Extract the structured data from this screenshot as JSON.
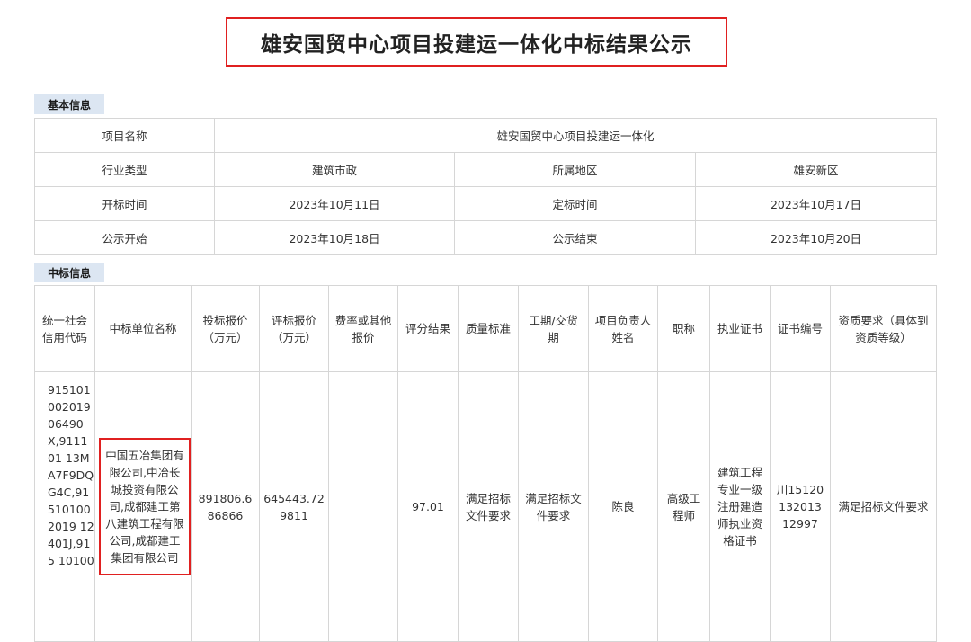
{
  "title": "雄安国贸中心项目投建运一体化中标结果公示",
  "basic": {
    "section_label": "基本信息",
    "project_name_label": "项目名称",
    "project_name_value": "雄安国贸中心项目投建运一体化",
    "industry_label": "行业类型",
    "industry_value": "建筑市政",
    "region_label": "所属地区",
    "region_value": "雄安新区",
    "open_time_label": "开标时间",
    "open_time_value": "2023年10月11日",
    "decide_time_label": "定标时间",
    "decide_time_value": "2023年10月17日",
    "publish_start_label": "公示开始",
    "publish_start_value": "2023年10月18日",
    "publish_end_label": "公示结束",
    "publish_end_value": "2023年10月20日"
  },
  "award": {
    "section_label": "中标信息",
    "headers": {
      "credit_code": "统一社会信用代码",
      "winner": "中标单位名称",
      "bid_price": "投标报价（万元）",
      "eval_price": "评标报价（万元）",
      "rate": "费率或其他报价",
      "score": "评分结果",
      "quality": "质量标准",
      "period": "工期/交货期",
      "manager": "项目负责人姓名",
      "title": "职称",
      "cert": "执业证书",
      "cert_no": "证书编号",
      "qualification": "资质要求（具体到资质等级）"
    },
    "row": {
      "credit_code": "91510100201906490X,911101 13MA7F9DQG4C,915101002019 12401J,915 10100",
      "winner": "中国五冶集团有限公司,中冶长城投资有限公司,成都建工第八建筑工程有限公司,成都建工集团有限公司",
      "bid_price": "891806.686866",
      "eval_price": "645443.729811",
      "rate": "",
      "score": "97.01",
      "quality": "满足招标文件要求",
      "period": "满足招标文件要求",
      "manager": "陈良",
      "title": "高级工程师",
      "cert": "建筑工程专业一级注册建造师执业资格证书",
      "cert_no": "川15120132013 12997",
      "qualification": "满足招标文件要求"
    }
  }
}
